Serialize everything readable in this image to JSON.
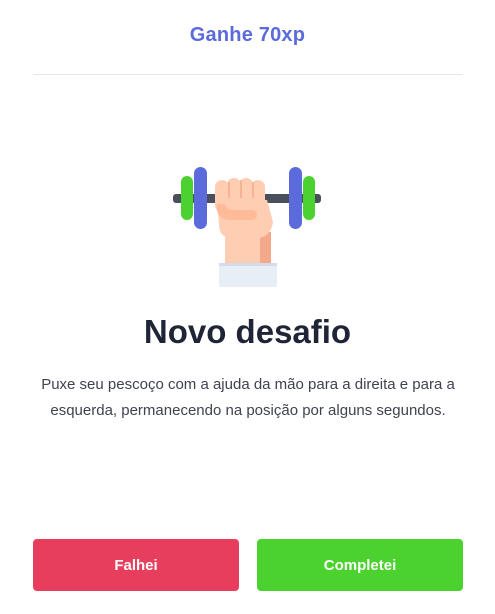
{
  "header": {
    "xp_label": "Ganhe 70xp"
  },
  "challenge": {
    "icon": "dumbbell-fist-icon",
    "title": "Novo desafio",
    "description": "Puxe seu pescoço com a ajuda da mão para a direita e para a esquerda, permanecendo na posição por alguns segundos."
  },
  "actions": {
    "fail_label": "Falhei",
    "complete_label": "Completei"
  },
  "colors": {
    "accent": "#5b6bdc",
    "fail": "#e63e5c",
    "success": "#4bd22e",
    "heading": "#1f2536"
  }
}
